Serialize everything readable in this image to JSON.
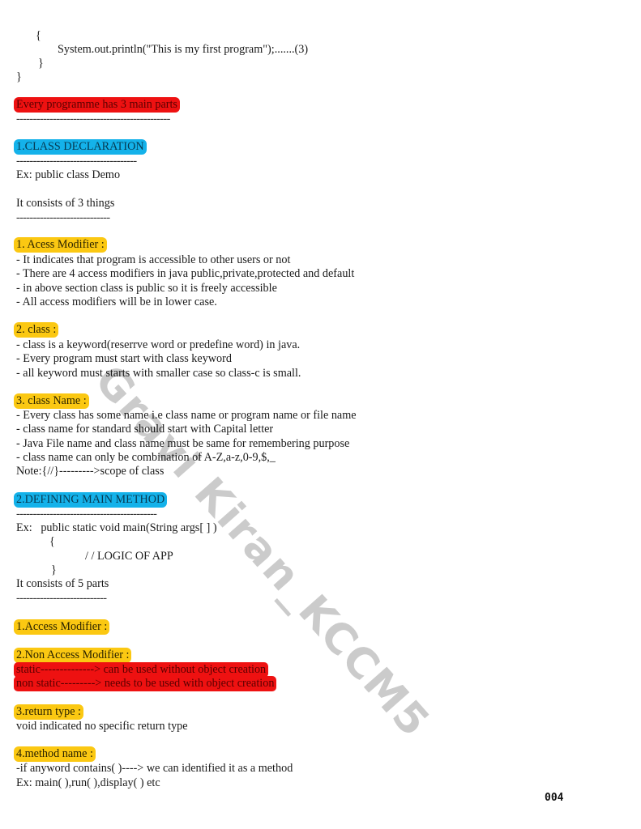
{
  "code_top": {
    "open_brace": "{",
    "println": "System.out.println(\"This is my first program\");.......(3)",
    "close_inner": "}",
    "close_outer": "}"
  },
  "intro": {
    "heading": "Every programme has 3 main parts",
    "divider": "----------------------------------------------"
  },
  "section1": {
    "heading": "1.CLASS DECLARATION",
    "divider": "------------------------------------",
    "example": "Ex: public class Demo",
    "consists": "It consists of 3 things",
    "consists_divider": "----------------------------",
    "parts": [
      {
        "title": "1. Acess Modifier :",
        "lines": [
          "- It indicates that program is accessible to other users or not",
          "- There are 4 access modifiers in java public,private,protected and default",
          "- in above section class is public so it is freely accessible",
          "- All access modifiers will be in lower case."
        ]
      },
      {
        "title": "2. class :",
        "lines": [
          "- class is a keyword(reserrve word or predefine word) in java.",
          "- Every program must start with class keyword",
          "- all keyword must starts with smaller case so class-c is small."
        ]
      },
      {
        "title": "3. class Name :",
        "lines": [
          "- Every class has some name i.e class name or program name or file name",
          "- class name for standard should start with Capital letter",
          "- Java File name and class name must be same for remembering purpose",
          "- class name can only be combination of A-Z,a-z,0-9,$,_",
          "Note:{//}--------->scope of class"
        ]
      }
    ]
  },
  "section2": {
    "heading": "2.DEFINING MAIN METHOD",
    "divider": "------------------------------------------",
    "example": "Ex:   public static void main(String args[ ] )",
    "open_brace": "{",
    "logic": "/ / LOGIC OF APP",
    "close_brace": "}",
    "consists": "It consists of 5 parts",
    "consists_divider": "---------------------------",
    "parts": [
      {
        "title": "1.Access Modifier :"
      },
      {
        "title": "2.Non Access Modifier :",
        "highlighted_lines": [
          "static--------------> can be used without object creation",
          "non static---------> needs to be used with object creation"
        ]
      },
      {
        "title": "3.return type :",
        "lines": [
          "void indicated no specific return type"
        ]
      },
      {
        "title": "4.method name :",
        "lines": [
          "-if anyword contains( )----> we can identified it as a method",
          "Ex: main( ),run( ),display( ) etc"
        ]
      }
    ]
  },
  "watermark": "Gravi Kiran_KCCM5",
  "page_number": "004",
  "colors": {
    "red_highlight": "#ee1111",
    "blue_highlight": "#14b2ea",
    "yellow_highlight": "#fbc812"
  }
}
